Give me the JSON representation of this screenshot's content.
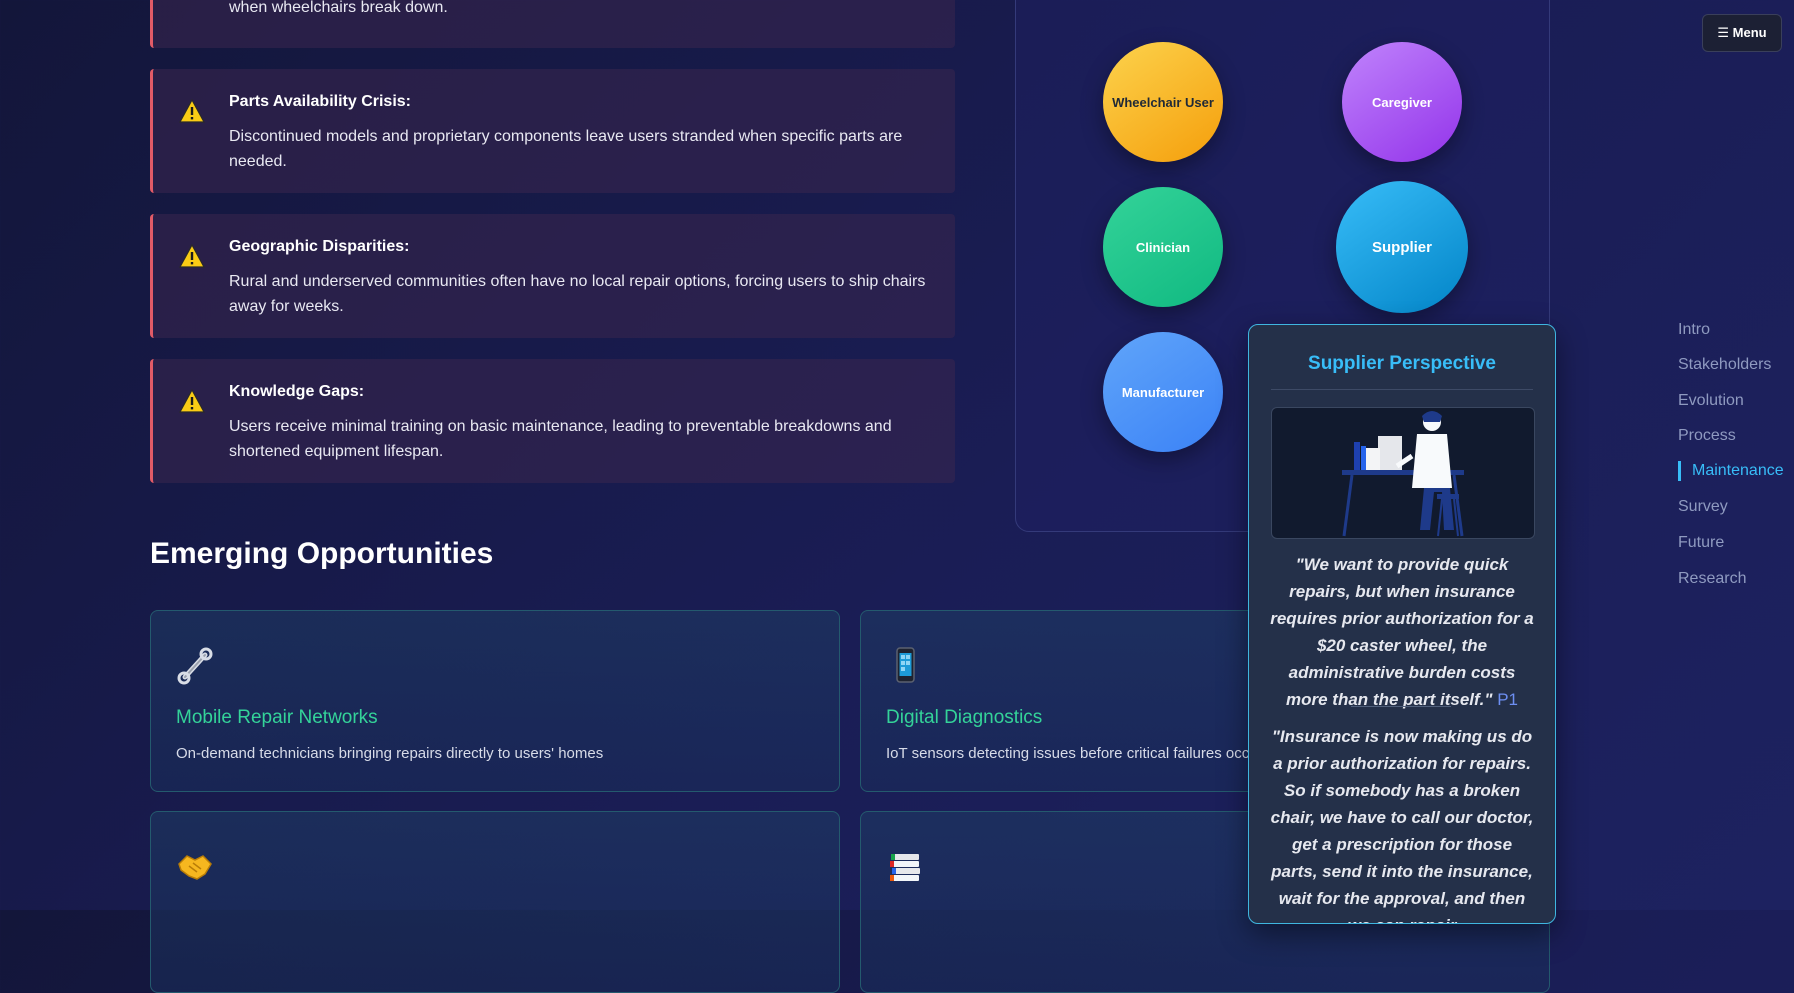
{
  "challenges": [
    {
      "title": "",
      "description": "when wheelchairs break down."
    },
    {
      "title": "Parts Availability Crisis:",
      "description": "Discontinued models and proprietary components leave users stranded when specific parts are needed."
    },
    {
      "title": "Geographic Disparities:",
      "description": "Rural and underserved communities often have no local repair options, forcing users to ship chairs away for weeks."
    },
    {
      "title": "Knowledge Gaps:",
      "description": "Users receive minimal training on basic maintenance, leading to preventable breakdowns and shortened equipment lifespan."
    }
  ],
  "challenge_icon": "warning-icon",
  "opportunities": {
    "heading": "Emerging Opportunities",
    "items": [
      {
        "icon": "wrench-icon",
        "title": "Mobile Repair Networks",
        "description": "On-demand technicians bringing repairs directly to users' homes"
      },
      {
        "icon": "phone-icon",
        "title": "Digital Diagnostics",
        "description": "IoT sensors detecting issues before critical failures occur"
      },
      {
        "icon": "handshake-icon",
        "title": "",
        "description": ""
      },
      {
        "icon": "books-icon",
        "title": "",
        "description": ""
      }
    ]
  },
  "stakeholders": {
    "items": [
      {
        "label": "Wheelchair User",
        "color": "#fbbf24"
      },
      {
        "label": "Caregiver",
        "color": "#a855f7"
      },
      {
        "label": "Clinician",
        "color": "#34d399"
      },
      {
        "label": "Supplier",
        "color": "#0ea5e9"
      },
      {
        "label": "Manufacturer",
        "color": "#3b82f6"
      }
    ]
  },
  "popup": {
    "title": "Supplier Perspective",
    "quote1": "\"We want to provide quick repairs, but when insurance requires prior authorization for a $20 caster wheel, the administrative burden costs more than the part itself.\"",
    "quote1_tag": "P1",
    "quote2": "\"Insurance is now making us do a prior authorization for repairs. So if somebody has a broken chair, we have to call our doctor, get a prescription for those parts, send it into the insurance, wait for the approval, and then we can repair"
  },
  "menu": {
    "label": "☰ Menu"
  },
  "nav": {
    "items": [
      "Intro",
      "Stakeholders",
      "Evolution",
      "Process",
      "Maintenance",
      "Survey",
      "Future",
      "Research"
    ],
    "active": "Maintenance"
  },
  "colors": {
    "accent": "#38bdf8",
    "warning_border": "#e15b67",
    "opportunity_title": "#34d399"
  }
}
